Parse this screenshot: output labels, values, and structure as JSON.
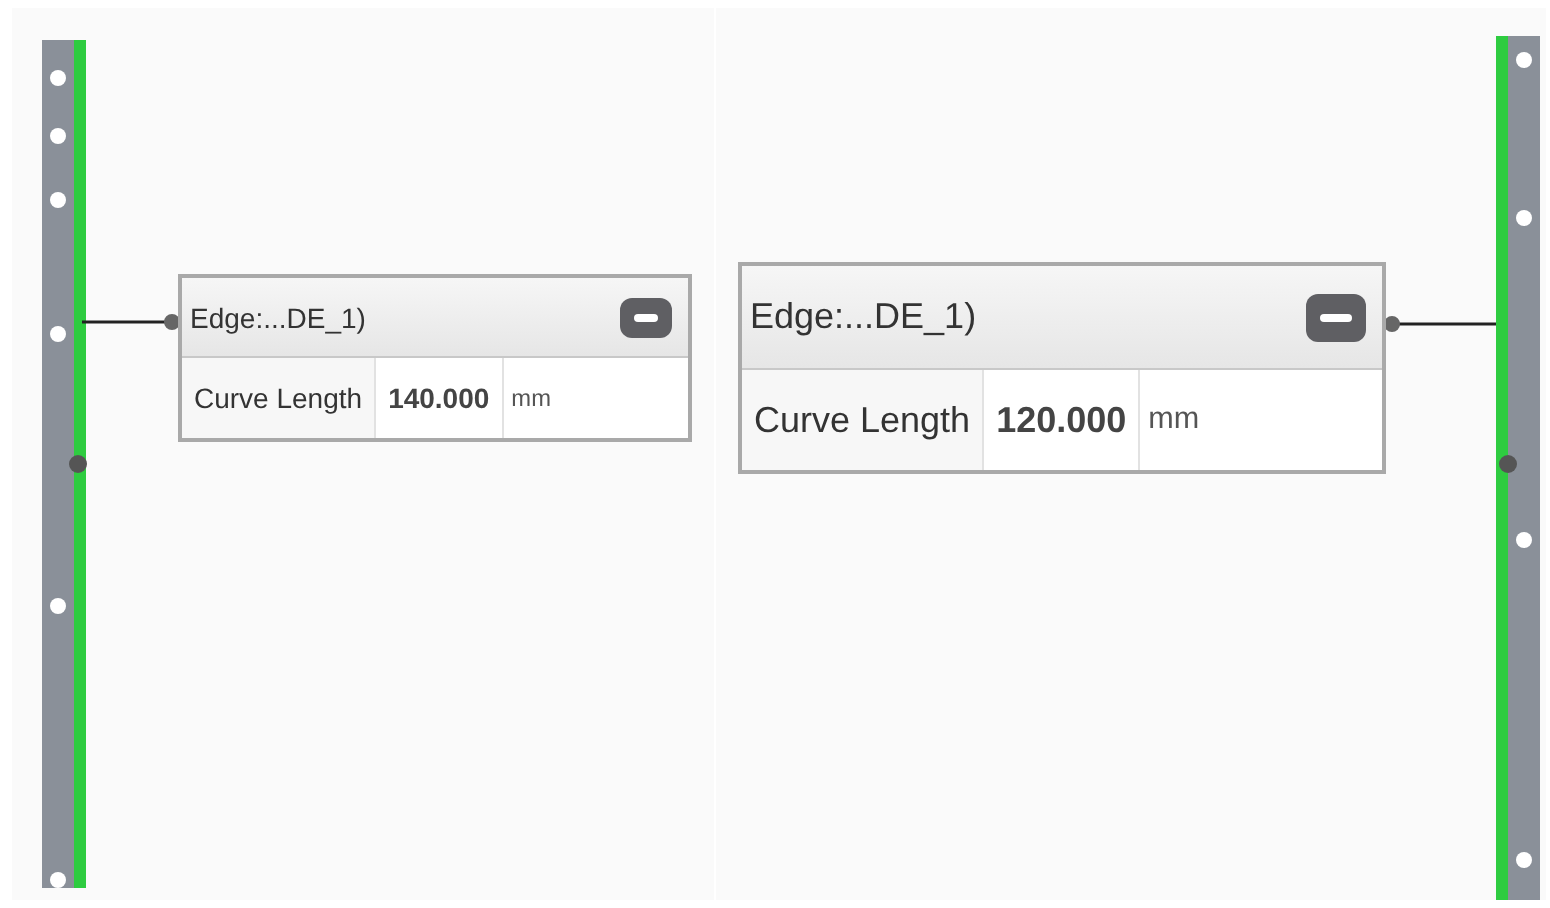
{
  "panels": [
    {
      "kind": "left",
      "node": {
        "title": "Edge:...DE_1)",
        "parameter": {
          "label": "Curve Length",
          "value": "140.000",
          "unit": "mm"
        }
      }
    },
    {
      "kind": "right",
      "node": {
        "title": "Edge:...DE_1)",
        "parameter": {
          "label": "Curve Length",
          "value": "120.000",
          "unit": "mm"
        }
      }
    }
  ]
}
